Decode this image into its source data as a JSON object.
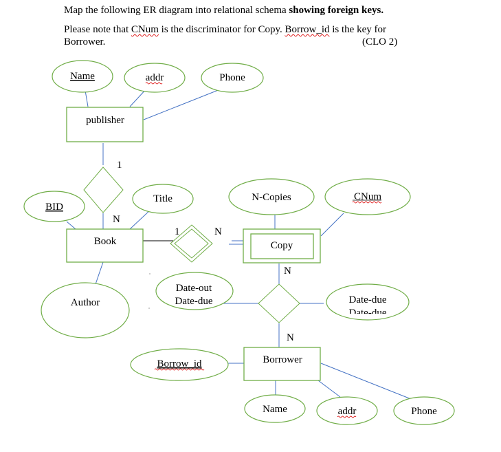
{
  "question": {
    "line1_normal": "Map the following ER diagram into relational schema ",
    "line1_bold": "showing foreign keys.",
    "line2_a": "Please note that ",
    "line2_cnum": "CNum",
    "line2_b": " is the discriminator for Copy.  ",
    "line2_borrow": "Borrow_id",
    "line2_c": " is the key for",
    "line3": "Borrower.",
    "clo": "(CLO 2)"
  },
  "colors": {
    "shape_stroke": "#70ad47",
    "line_blue": "#4472c4",
    "line_black": "#000000",
    "spell_squiggle": "#e02020"
  },
  "entities": [
    {
      "id": "publisher",
      "label": "publisher",
      "weak": false
    },
    {
      "id": "book",
      "label": "Book",
      "weak": false
    },
    {
      "id": "copy",
      "label": "Copy",
      "weak": true
    },
    {
      "id": "borrower",
      "label": "Borrower",
      "weak": false
    }
  ],
  "attributes": [
    {
      "id": "pub-name",
      "label": "Name",
      "key": true,
      "of": "publisher"
    },
    {
      "id": "pub-addr",
      "label": "addr",
      "key": false,
      "of": "publisher",
      "spell": true
    },
    {
      "id": "pub-phone",
      "label": "Phone",
      "key": false,
      "of": "publisher"
    },
    {
      "id": "book-bid",
      "label": "BID",
      "key": true,
      "of": "book"
    },
    {
      "id": "book-title",
      "label": "Title",
      "key": false,
      "of": "book"
    },
    {
      "id": "book-author",
      "label": "Author",
      "key": false,
      "of": "book"
    },
    {
      "id": "copy-ncopies",
      "label": "N-Copies",
      "key": false,
      "of": "copy"
    },
    {
      "id": "copy-cnum",
      "label": "CNum",
      "key": false,
      "of": "copy",
      "spell": true
    },
    {
      "id": "rel-dateout",
      "label": "Date-out",
      "ghost": "Date-due",
      "of": "borrows"
    },
    {
      "id": "rel-datedue",
      "label": "Date-due",
      "ghost": "Date-due",
      "of": "borrows"
    },
    {
      "id": "bor-id",
      "label": "Borrow_id",
      "key": true,
      "of": "borrower",
      "spell": true
    },
    {
      "id": "bor-name",
      "label": "Name",
      "key": false,
      "of": "borrower"
    },
    {
      "id": "bor-addr",
      "label": "addr",
      "key": false,
      "of": "borrower",
      "spell": true
    },
    {
      "id": "bor-phone",
      "label": "Phone",
      "key": false,
      "of": "borrower"
    }
  ],
  "relationships": [
    {
      "id": "publishes",
      "between": [
        "publisher",
        "book"
      ],
      "cardinality": [
        "1",
        "N"
      ],
      "identifying": false
    },
    {
      "id": "has-copy",
      "between": [
        "book",
        "copy"
      ],
      "cardinality": [
        "1",
        "N"
      ],
      "identifying": true
    },
    {
      "id": "borrows",
      "between": [
        "copy",
        "borrower"
      ],
      "cardinality": [
        "N",
        "N"
      ],
      "identifying": false
    }
  ]
}
